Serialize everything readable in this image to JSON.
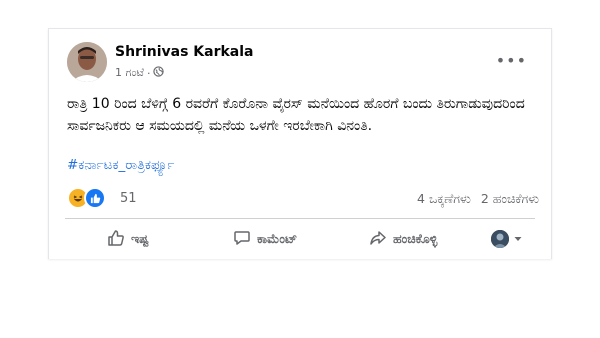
{
  "post": {
    "author": "Shrinivas Karkala",
    "time": "1 ಗಂಟೆ",
    "separator": "·",
    "text": "ರಾತ್ರಿ 10 ರಿಂದ ಬೆಳಿಗ್ಗೆ 6 ರವರೆಗೆ ಕೊರೊನಾ ವೈರಸ್ ಮನೆಯಿಂದ ಹೊರಗೆ ಬಂದು ತಿರುಗಾಡುವುದರಿಂದ ಸಾರ್ವಜನಿಕರು ಆ ಸಮಯದಲ್ಲಿ ಮನೆಯ ಒಳಗೇ ಇರಬೇಕಾಗಿ ವಿನಂತಿ.",
    "hashtag": "#ಕರ್ನಾಟಕ_ರಾತ್ರಿಕರ್ಫ್ಯೂ",
    "more": "•••"
  },
  "reactions": {
    "count": "51",
    "icons": [
      "haha-icon",
      "like-icon"
    ]
  },
  "stats": {
    "comments": "4 ಒಕ್ಕಣೆಗಳು",
    "shares": "2 ಹಂಚಿಕೆಗಳು"
  },
  "actions": {
    "like": "ಇಷ್ಟ",
    "comment": "ಕಾಮೆಂಟ್",
    "share": "ಹಂಚಿಕೊಳ್ಳಿ"
  },
  "colors": {
    "link": "#216fdb",
    "muted": "#65676b",
    "like": "#1877f2",
    "haha": "#f7b125"
  }
}
